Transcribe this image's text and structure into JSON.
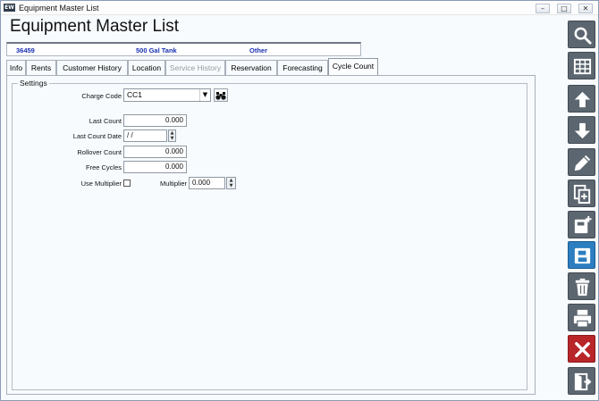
{
  "window": {
    "title": "Equipment Master List",
    "app_icon_text": "EW"
  },
  "header": {
    "title": "Equipment Master List"
  },
  "info": {
    "id": "36459",
    "description": "500 Gal Tank",
    "category": "Other"
  },
  "tabs": [
    {
      "label": "Info"
    },
    {
      "label": "Rents"
    },
    {
      "label": "Customer History"
    },
    {
      "label": "Location"
    },
    {
      "label": "Service History"
    },
    {
      "label": "Reservation"
    },
    {
      "label": "Forecasting"
    },
    {
      "label": "Cycle Count"
    }
  ],
  "settings": {
    "legend": "Settings",
    "charge_code": {
      "label": "Charge Code",
      "value": "CC1"
    },
    "last_count": {
      "label": "Last Count",
      "value": "0.000"
    },
    "last_count_date": {
      "label": "Last Count Date",
      "value": " / /"
    },
    "rollover_count": {
      "label": "Rollover Count",
      "value": "0.000"
    },
    "free_cycles": {
      "label": "Free Cycles",
      "value": "0.000"
    },
    "use_multiplier": {
      "label": "Use Multiplier",
      "checked": false
    },
    "multiplier": {
      "label": "Multiplier",
      "value": "0.000"
    }
  },
  "toolbar": {
    "buttons": [
      "search-icon",
      "grid-icon",
      "arrow-up-icon",
      "arrow-down-icon",
      "pencil-icon",
      "copy-icon",
      "new-record-icon",
      "save-icon",
      "trash-icon",
      "print-icon",
      "close-icon",
      "exit-icon"
    ]
  }
}
